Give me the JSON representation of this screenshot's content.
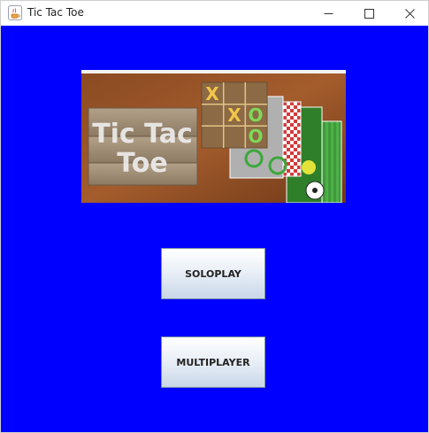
{
  "window": {
    "title": "Tic Tac Toe",
    "icon": "java-cup-icon",
    "controls": [
      "minimize-icon",
      "maximize-icon",
      "close-icon"
    ]
  },
  "banner": {
    "title_line1": "Tic Tac",
    "title_line2": "Toe",
    "board_marks": [
      "X",
      "X",
      "O",
      "O"
    ]
  },
  "buttons": {
    "solo_label": "SOLOPLAY",
    "multi_label": "MULTIPLAYER"
  },
  "colors": {
    "background": "#0000ff",
    "button_top": "#ffffff",
    "button_bottom": "#c9d7e8"
  }
}
